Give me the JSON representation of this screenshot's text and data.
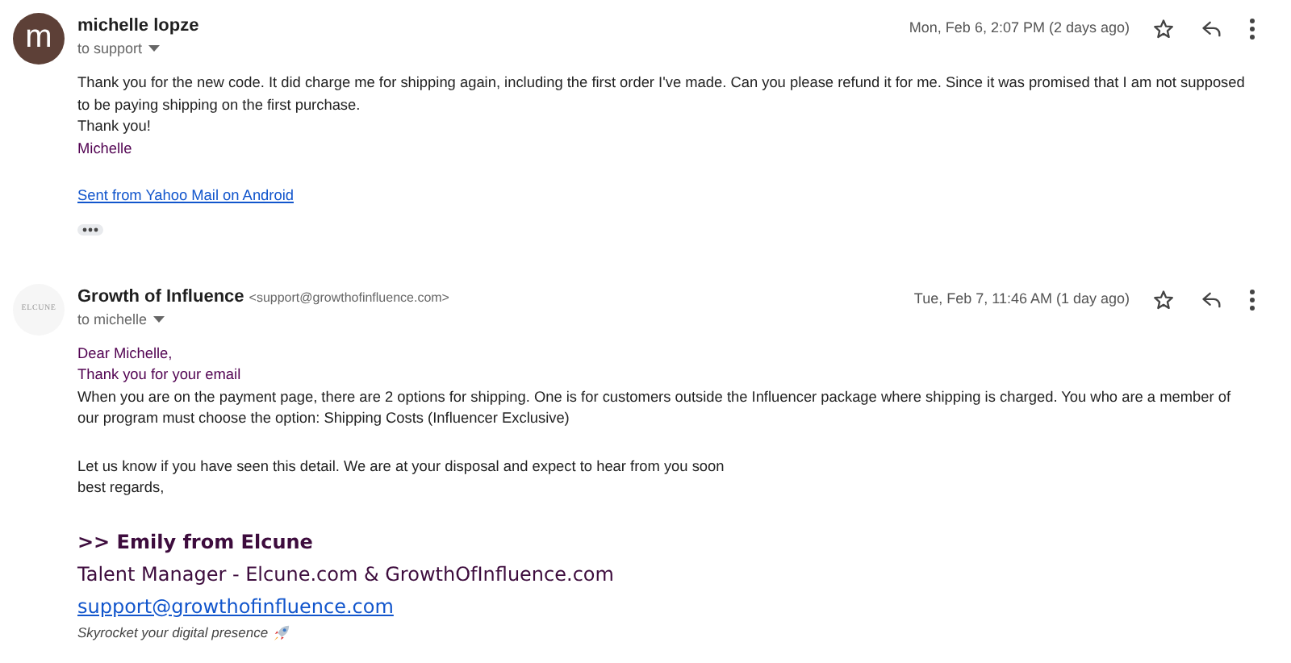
{
  "messages": [
    {
      "avatar": {
        "kind": "letter",
        "text": "m"
      },
      "sender": "michelle lopze",
      "recipient": "to support",
      "date": "Mon, Feb 6, 2:07 PM (2 days ago)",
      "body": [
        {
          "kind": "plain",
          "text": "Thank you for the new code. It did charge me for shipping again, including the first order I've made. Can you please refund it for me. Since it was promised that I am not supposed to be paying shipping on the first purchase."
        },
        {
          "kind": "plain",
          "text": "Thank you!"
        },
        {
          "kind": "accent",
          "text": "Michelle"
        },
        {
          "kind": "gap"
        },
        {
          "kind": "link",
          "text": "Sent from Yahoo Mail on Android"
        }
      ],
      "trimmed": true
    },
    {
      "avatar": {
        "kind": "logo",
        "text": "ELCUNE"
      },
      "sender": "Growth of Influence",
      "email": "<support@growthofinfluence.com>",
      "recipient": "to michelle",
      "date": "Tue, Feb 7, 11:46 AM (1 day ago)",
      "body": [
        {
          "kind": "accent",
          "text": "Dear Michelle,"
        },
        {
          "kind": "accent",
          "text": "Thank you for your email"
        },
        {
          "kind": "plain",
          "text": "When you are on the payment page, there are 2 options for shipping. One is for customers outside the Influencer package where shipping is charged. You who are a member of our program must choose the option: Shipping Costs (Influencer Exclusive)"
        },
        {
          "kind": "gap"
        },
        {
          "kind": "plain",
          "text": "Let us know if you have seen this detail. We are at your disposal and expect to hear from you soon"
        },
        {
          "kind": "plain",
          "text": "best regards,"
        },
        {
          "kind": "gap"
        },
        {
          "kind": "sig-name",
          "text": ">> Emily from Elcune"
        },
        {
          "kind": "sig-title",
          "text": "Talent Manager - Elcune.com & GrowthOfInfluence.com"
        },
        {
          "kind": "sig-link",
          "text": "support@growthofinfluence.com"
        },
        {
          "kind": "sig-tagline",
          "text": "Skyrocket your digital presence"
        }
      ],
      "trimmed": false
    }
  ]
}
